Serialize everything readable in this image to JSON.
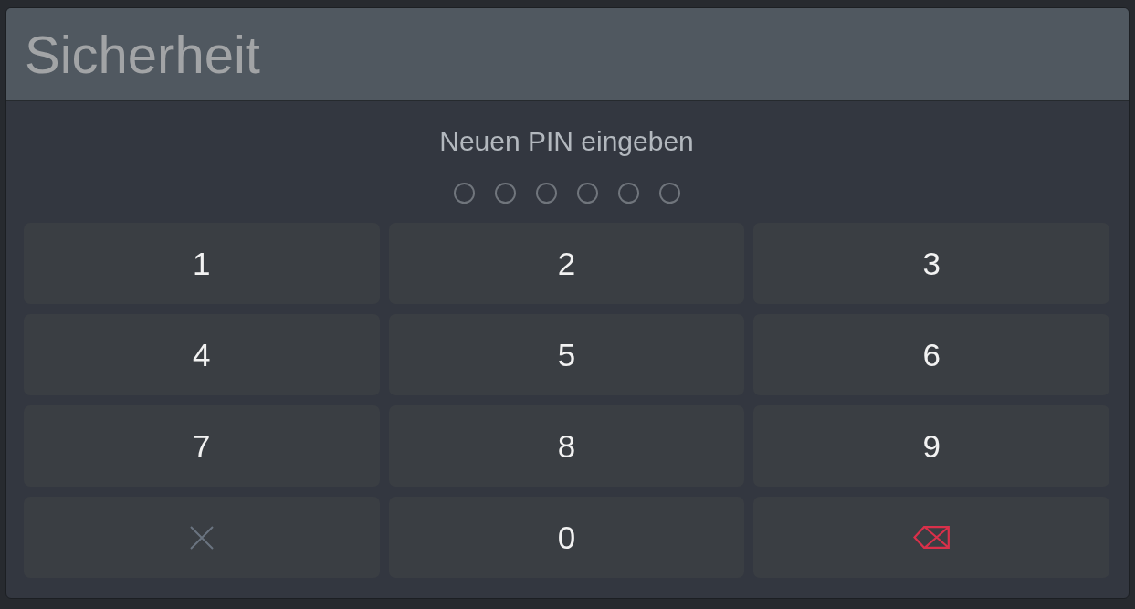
{
  "dialog": {
    "title": "Sicherheit"
  },
  "prompt": "Neuen PIN eingeben",
  "pin_dots": [
    {
      "filled": false
    },
    {
      "filled": false
    },
    {
      "filled": false
    },
    {
      "filled": false
    },
    {
      "filled": false
    },
    {
      "filled": false
    }
  ],
  "keypad": [
    {
      "kind": "digit",
      "label": "1"
    },
    {
      "kind": "digit",
      "label": "2"
    },
    {
      "kind": "digit",
      "label": "3"
    },
    {
      "kind": "digit",
      "label": "4"
    },
    {
      "kind": "digit",
      "label": "5"
    },
    {
      "kind": "digit",
      "label": "6"
    },
    {
      "kind": "digit",
      "label": "7"
    },
    {
      "kind": "digit",
      "label": "8"
    },
    {
      "kind": "digit",
      "label": "9"
    },
    {
      "kind": "clear"
    },
    {
      "kind": "digit",
      "label": "0"
    },
    {
      "kind": "backspace"
    }
  ]
}
